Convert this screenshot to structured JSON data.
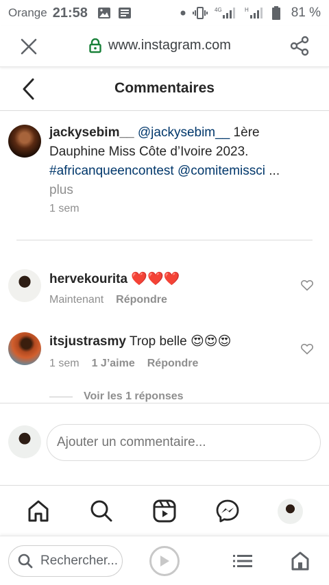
{
  "status_bar": {
    "carrier": "Orange",
    "time": "21:58",
    "network_label": "4G",
    "network_label_2": "H",
    "battery": "81 %"
  },
  "browser": {
    "url": "www.instagram.com",
    "search_label": "Rechercher..."
  },
  "header": {
    "title": "Commentaires"
  },
  "caption": {
    "username": "jackysebim__",
    "mention": "@jackysebim__",
    "text": " 1ère Dauphine Miss Côte d’Ivoire 2023. ",
    "hashtag": "#africanqueencontest",
    "mention2": "@comitemissci",
    "ellipsis": " ...",
    "more": "plus",
    "time": "1 sem"
  },
  "comments": [
    {
      "username": "hervekourita",
      "text": " ❤️❤️❤️",
      "time": "Maintenant",
      "likes": "",
      "reply": "Répondre"
    },
    {
      "username": "itsjustrasmy",
      "text": " Trop belle 😍😍😍",
      "time": "1 sem",
      "likes": "1 J’aime",
      "reply": "Répondre",
      "view_replies": "Voir les 1 réponses"
    }
  ],
  "add_comment": {
    "placeholder": "Ajouter un commentaire..."
  },
  "icons": {
    "accent_link": "#00376b",
    "secure_lock": "#188038"
  }
}
